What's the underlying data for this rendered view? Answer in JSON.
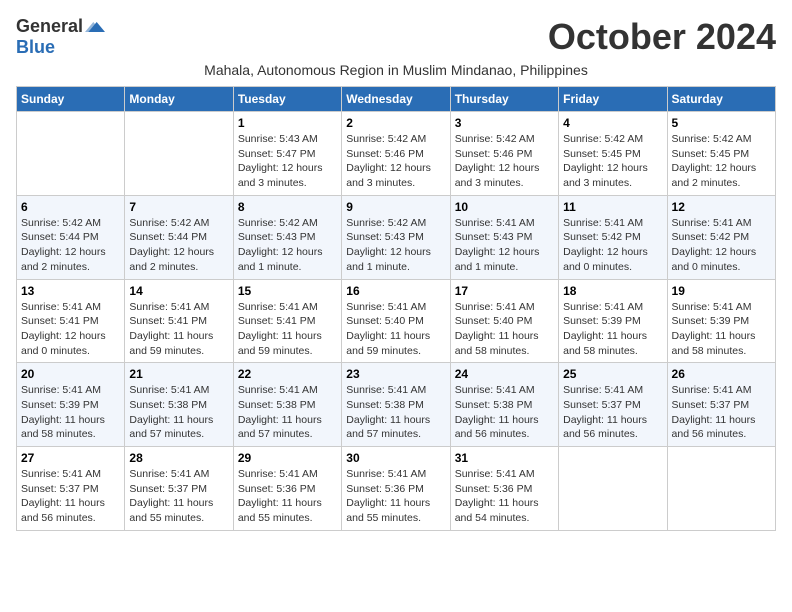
{
  "header": {
    "logo_general": "General",
    "logo_blue": "Blue",
    "month_title": "October 2024",
    "subtitle": "Mahala, Autonomous Region in Muslim Mindanao, Philippines"
  },
  "weekdays": [
    "Sunday",
    "Monday",
    "Tuesday",
    "Wednesday",
    "Thursday",
    "Friday",
    "Saturday"
  ],
  "weeks": [
    [
      {
        "day": "",
        "info": ""
      },
      {
        "day": "",
        "info": ""
      },
      {
        "day": "1",
        "info": "Sunrise: 5:43 AM\nSunset: 5:47 PM\nDaylight: 12 hours and 3 minutes."
      },
      {
        "day": "2",
        "info": "Sunrise: 5:42 AM\nSunset: 5:46 PM\nDaylight: 12 hours and 3 minutes."
      },
      {
        "day": "3",
        "info": "Sunrise: 5:42 AM\nSunset: 5:46 PM\nDaylight: 12 hours and 3 minutes."
      },
      {
        "day": "4",
        "info": "Sunrise: 5:42 AM\nSunset: 5:45 PM\nDaylight: 12 hours and 3 minutes."
      },
      {
        "day": "5",
        "info": "Sunrise: 5:42 AM\nSunset: 5:45 PM\nDaylight: 12 hours and 2 minutes."
      }
    ],
    [
      {
        "day": "6",
        "info": "Sunrise: 5:42 AM\nSunset: 5:44 PM\nDaylight: 12 hours and 2 minutes."
      },
      {
        "day": "7",
        "info": "Sunrise: 5:42 AM\nSunset: 5:44 PM\nDaylight: 12 hours and 2 minutes."
      },
      {
        "day": "8",
        "info": "Sunrise: 5:42 AM\nSunset: 5:43 PM\nDaylight: 12 hours and 1 minute."
      },
      {
        "day": "9",
        "info": "Sunrise: 5:42 AM\nSunset: 5:43 PM\nDaylight: 12 hours and 1 minute."
      },
      {
        "day": "10",
        "info": "Sunrise: 5:41 AM\nSunset: 5:43 PM\nDaylight: 12 hours and 1 minute."
      },
      {
        "day": "11",
        "info": "Sunrise: 5:41 AM\nSunset: 5:42 PM\nDaylight: 12 hours and 0 minutes."
      },
      {
        "day": "12",
        "info": "Sunrise: 5:41 AM\nSunset: 5:42 PM\nDaylight: 12 hours and 0 minutes."
      }
    ],
    [
      {
        "day": "13",
        "info": "Sunrise: 5:41 AM\nSunset: 5:41 PM\nDaylight: 12 hours and 0 minutes."
      },
      {
        "day": "14",
        "info": "Sunrise: 5:41 AM\nSunset: 5:41 PM\nDaylight: 11 hours and 59 minutes."
      },
      {
        "day": "15",
        "info": "Sunrise: 5:41 AM\nSunset: 5:41 PM\nDaylight: 11 hours and 59 minutes."
      },
      {
        "day": "16",
        "info": "Sunrise: 5:41 AM\nSunset: 5:40 PM\nDaylight: 11 hours and 59 minutes."
      },
      {
        "day": "17",
        "info": "Sunrise: 5:41 AM\nSunset: 5:40 PM\nDaylight: 11 hours and 58 minutes."
      },
      {
        "day": "18",
        "info": "Sunrise: 5:41 AM\nSunset: 5:39 PM\nDaylight: 11 hours and 58 minutes."
      },
      {
        "day": "19",
        "info": "Sunrise: 5:41 AM\nSunset: 5:39 PM\nDaylight: 11 hours and 58 minutes."
      }
    ],
    [
      {
        "day": "20",
        "info": "Sunrise: 5:41 AM\nSunset: 5:39 PM\nDaylight: 11 hours and 58 minutes."
      },
      {
        "day": "21",
        "info": "Sunrise: 5:41 AM\nSunset: 5:38 PM\nDaylight: 11 hours and 57 minutes."
      },
      {
        "day": "22",
        "info": "Sunrise: 5:41 AM\nSunset: 5:38 PM\nDaylight: 11 hours and 57 minutes."
      },
      {
        "day": "23",
        "info": "Sunrise: 5:41 AM\nSunset: 5:38 PM\nDaylight: 11 hours and 57 minutes."
      },
      {
        "day": "24",
        "info": "Sunrise: 5:41 AM\nSunset: 5:38 PM\nDaylight: 11 hours and 56 minutes."
      },
      {
        "day": "25",
        "info": "Sunrise: 5:41 AM\nSunset: 5:37 PM\nDaylight: 11 hours and 56 minutes."
      },
      {
        "day": "26",
        "info": "Sunrise: 5:41 AM\nSunset: 5:37 PM\nDaylight: 11 hours and 56 minutes."
      }
    ],
    [
      {
        "day": "27",
        "info": "Sunrise: 5:41 AM\nSunset: 5:37 PM\nDaylight: 11 hours and 56 minutes."
      },
      {
        "day": "28",
        "info": "Sunrise: 5:41 AM\nSunset: 5:37 PM\nDaylight: 11 hours and 55 minutes."
      },
      {
        "day": "29",
        "info": "Sunrise: 5:41 AM\nSunset: 5:36 PM\nDaylight: 11 hours and 55 minutes."
      },
      {
        "day": "30",
        "info": "Sunrise: 5:41 AM\nSunset: 5:36 PM\nDaylight: 11 hours and 55 minutes."
      },
      {
        "day": "31",
        "info": "Sunrise: 5:41 AM\nSunset: 5:36 PM\nDaylight: 11 hours and 54 minutes."
      },
      {
        "day": "",
        "info": ""
      },
      {
        "day": "",
        "info": ""
      }
    ]
  ]
}
